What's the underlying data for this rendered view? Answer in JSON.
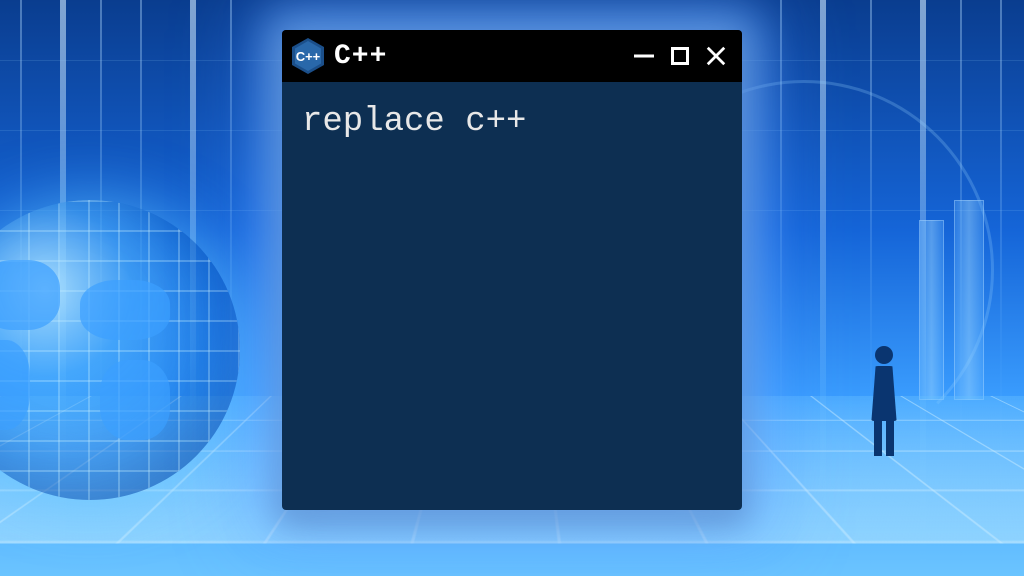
{
  "window": {
    "title": "C++",
    "icon_label": "C++",
    "content": "replace c++"
  },
  "controls": {
    "minimize": "minimize",
    "maximize": "maximize",
    "close": "close"
  },
  "colors": {
    "window_bg": "#0d2f52",
    "titlebar_bg": "#000000",
    "glow": "#78b4ff"
  }
}
